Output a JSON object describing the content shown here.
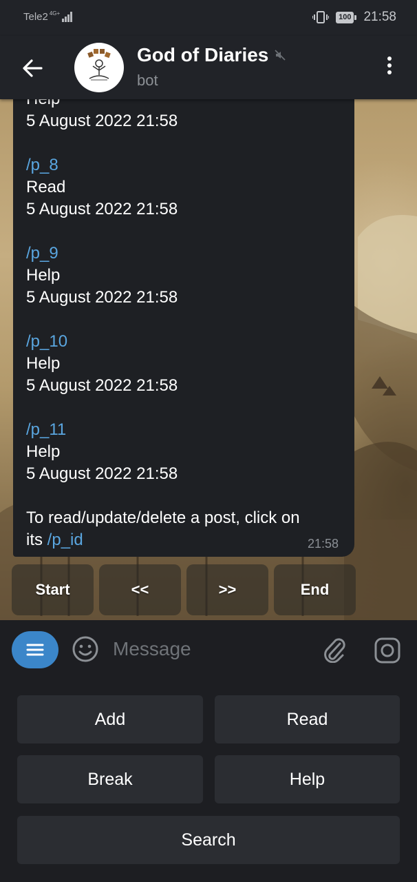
{
  "status_bar": {
    "carrier": "Tele2",
    "network": "4G+",
    "battery": "100",
    "time": "21:58"
  },
  "header": {
    "title": "God of Diaries",
    "subtitle": "bot"
  },
  "message": {
    "lines": [
      {
        "text": "Help",
        "type": "text"
      },
      {
        "text": "5 August 2022 21:58",
        "type": "text"
      },
      {
        "text": "",
        "type": "gap"
      },
      {
        "text": "/p_8",
        "type": "link"
      },
      {
        "text": "Read",
        "type": "text"
      },
      {
        "text": "5 August 2022 21:58",
        "type": "text"
      },
      {
        "text": "",
        "type": "gap"
      },
      {
        "text": "/p_9",
        "type": "link"
      },
      {
        "text": "Help",
        "type": "text"
      },
      {
        "text": "5 August 2022 21:58",
        "type": "text"
      },
      {
        "text": "",
        "type": "gap"
      },
      {
        "text": "/p_10",
        "type": "link"
      },
      {
        "text": "Help",
        "type": "text"
      },
      {
        "text": "5 August 2022 21:58",
        "type": "text"
      },
      {
        "text": "",
        "type": "gap"
      },
      {
        "text": "/p_11",
        "type": "link"
      },
      {
        "text": "Help",
        "type": "text"
      },
      {
        "text": "5 August 2022 21:58",
        "type": "text"
      },
      {
        "text": "",
        "type": "gap"
      }
    ],
    "footer_line1": "To read/update/delete a post, click on",
    "footer_line2_prefix": "its ",
    "footer_link": "/p_id",
    "time": "21:58"
  },
  "inline_keyboard": [
    "Start",
    "<<",
    ">>",
    "End"
  ],
  "input": {
    "placeholder": "Message"
  },
  "reply_keyboard": {
    "add": "Add",
    "read": "Read",
    "break": "Break",
    "help": "Help",
    "search": "Search"
  },
  "colors": {
    "accent": "#3b86c9",
    "link": "#5aa6e0",
    "bubble": "#1e2024",
    "panel": "#212328"
  }
}
